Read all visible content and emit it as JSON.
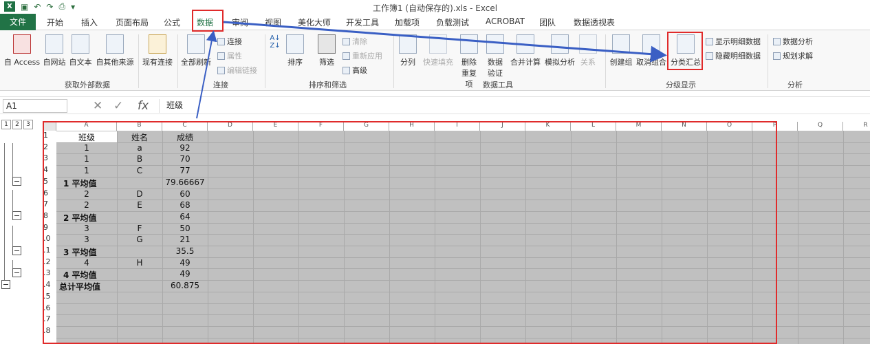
{
  "window": {
    "title": "工作簿1 (自动保存的).xls - Excel"
  },
  "tabs": {
    "file": "文件",
    "items": [
      "开始",
      "插入",
      "页面布局",
      "公式",
      "数据",
      "审阅",
      "视图",
      "美化大师",
      "开发工具",
      "加载项",
      "负载测试",
      "ACROBAT",
      "团队",
      "数据透视表"
    ],
    "active": "数据"
  },
  "ribbon": {
    "get_external": {
      "label": "获取外部数据",
      "btns": [
        "自 Access",
        "自网站",
        "自文本",
        "自其他来源",
        "现有连接"
      ]
    },
    "connections": {
      "label": "连接",
      "refresh": "全部刷新",
      "items": [
        "连接",
        "属性",
        "编辑链接"
      ]
    },
    "sort_filter": {
      "label": "排序和筛选",
      "sort": "排序",
      "filter": "筛选",
      "items": [
        "清除",
        "重新应用",
        "高级"
      ]
    },
    "data_tools": {
      "label": "数据工具",
      "btns": [
        "分列",
        "快速填充",
        "删除重复项",
        "数据验证",
        "合并计算",
        "模拟分析",
        "关系"
      ]
    },
    "outline": {
      "label": "分级显示",
      "btns": [
        "创建组",
        "取消组合",
        "分类汇总"
      ],
      "items": [
        "显示明细数据",
        "隐藏明细数据"
      ]
    },
    "analysis": {
      "label": "分析",
      "items": [
        "数据分析",
        "规划求解"
      ]
    }
  },
  "formula_bar": {
    "name_box": "A1",
    "formula": "班级"
  },
  "outline_levels": [
    "1",
    "2",
    "3"
  ],
  "columns": [
    "A",
    "B",
    "C",
    "D",
    "E",
    "F",
    "G",
    "H",
    "I",
    "J",
    "K",
    "L",
    "M",
    "N",
    "O",
    "P",
    "Q",
    "R"
  ],
  "rows": [
    "1",
    "2",
    "3",
    "4",
    "5",
    "6",
    "7",
    "8",
    "9",
    ".0",
    ".1",
    ".2",
    ".3",
    ".4",
    ".5",
    ".6",
    ".7",
    ".8"
  ],
  "table": [
    [
      "班级",
      "姓名",
      "成绩"
    ],
    [
      "1",
      "a",
      "92"
    ],
    [
      "1",
      "B",
      "70"
    ],
    [
      "1",
      "C",
      "77"
    ],
    [
      "1 平均值",
      "",
      "79.66667"
    ],
    [
      "2",
      "D",
      "60"
    ],
    [
      "2",
      "E",
      "68"
    ],
    [
      "2 平均值",
      "",
      "64"
    ],
    [
      "3",
      "F",
      "50"
    ],
    [
      "3",
      "G",
      "21"
    ],
    [
      "3 平均值",
      "",
      "35.5"
    ],
    [
      "4",
      "H",
      "49"
    ],
    [
      "4 平均值",
      "",
      "49"
    ],
    [
      "总计平均值",
      "",
      "60.875"
    ]
  ],
  "colors": {
    "accent": "#217346",
    "highlight": "#e02b2b",
    "arrow": "#3a5fc4"
  }
}
